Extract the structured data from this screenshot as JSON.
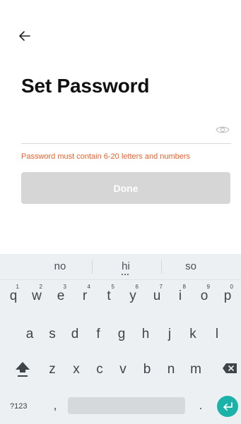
{
  "header": {
    "back_icon": "arrow-left-icon"
  },
  "page": {
    "title": "Set Password",
    "password_value": "",
    "visibility_icon": "eye-icon",
    "hint": "Password must contain 6-20 letters and numbers",
    "done_label": "Done"
  },
  "keyboard": {
    "suggestions": [
      "no",
      "hi",
      "so"
    ],
    "row1": [
      {
        "key": "q",
        "num": "1"
      },
      {
        "key": "w",
        "num": "2"
      },
      {
        "key": "e",
        "num": "3"
      },
      {
        "key": "r",
        "num": "4"
      },
      {
        "key": "t",
        "num": "5"
      },
      {
        "key": "y",
        "num": "6"
      },
      {
        "key": "u",
        "num": "7"
      },
      {
        "key": "i",
        "num": "8"
      },
      {
        "key": "o",
        "num": "9"
      },
      {
        "key": "p",
        "num": "0"
      }
    ],
    "row2": [
      "a",
      "s",
      "d",
      "f",
      "g",
      "h",
      "j",
      "k",
      "l"
    ],
    "row3": [
      "z",
      "x",
      "c",
      "v",
      "b",
      "n",
      "m"
    ],
    "symbols_label": "?123",
    "comma": ",",
    "period": ".",
    "enter_color": "#1bb3a8",
    "hint_color": "#f0612c"
  }
}
